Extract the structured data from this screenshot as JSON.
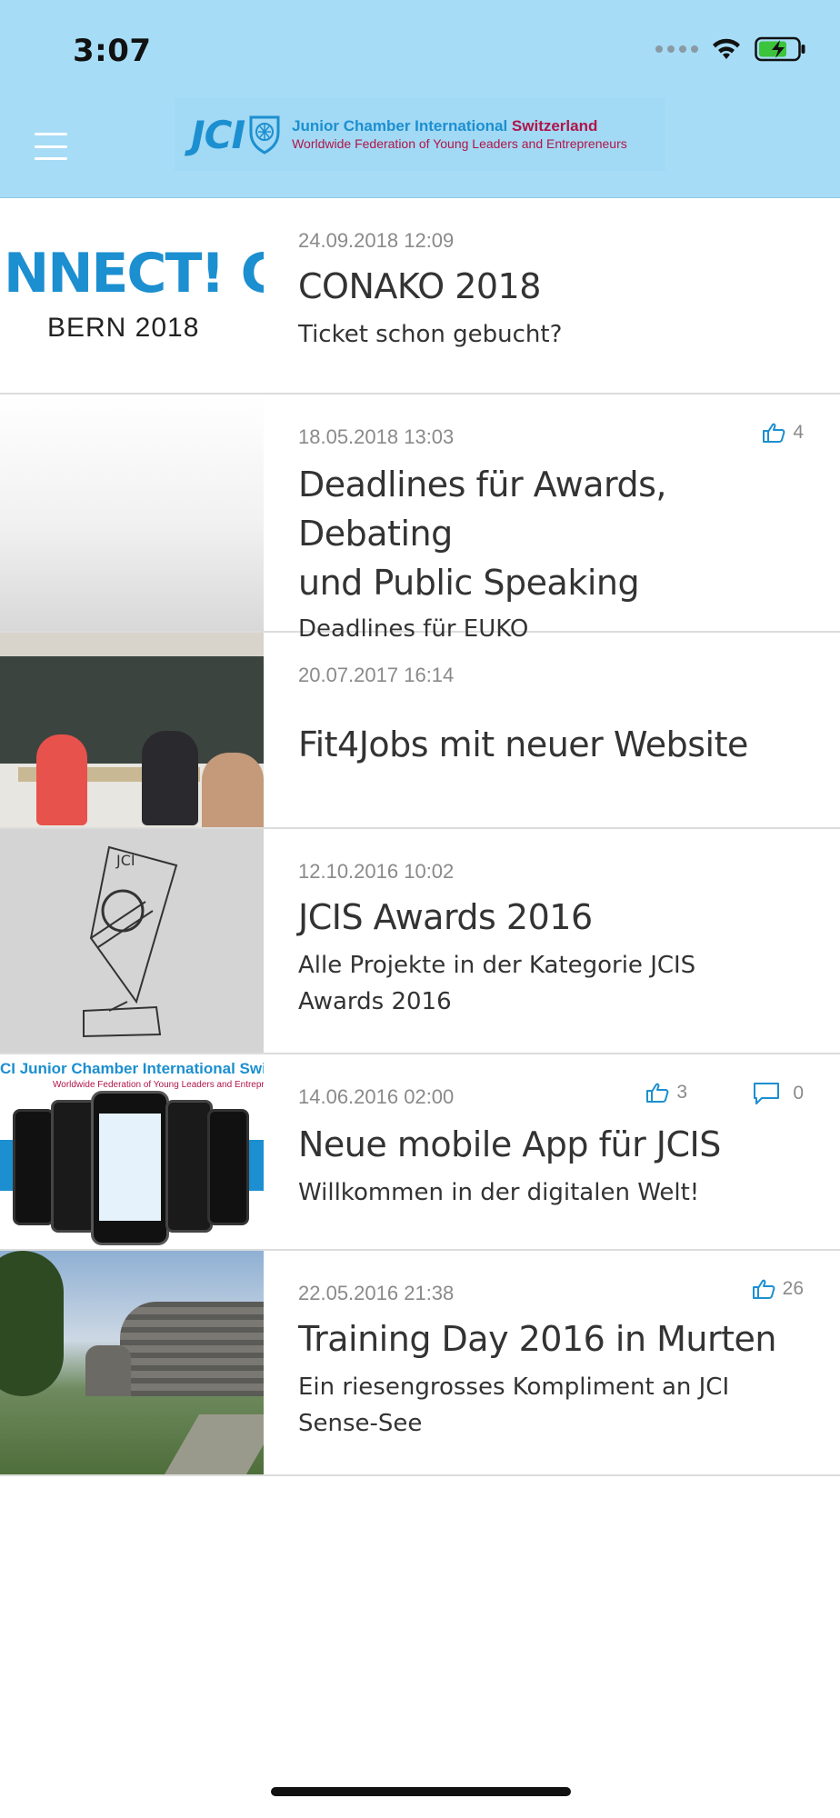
{
  "status_bar": {
    "time": "3:07"
  },
  "header": {
    "logo_mark": "JCI",
    "logo_line1": "Junior Chamber International",
    "logo_line1_accent": "Switzerland",
    "logo_line2": "Worldwide Federation of Young Leaders and Entrepreneurs"
  },
  "news": [
    {
      "date": "24.09.2018 12:09",
      "title": "CONAKO 2018",
      "subtitle": "Ticket schon gebucht?",
      "thumb_text1": "NNECT! C",
      "thumb_text2": "BERN 2018"
    },
    {
      "date": "18.05.2018 13:03",
      "likes": "4",
      "title_line1": "Deadlines für Awards, Debating",
      "title_line2": "und Public Speaking",
      "subtitle": "Deadlines für EUKO"
    },
    {
      "date": "20.07.2017 16:14",
      "title": "Fit4Jobs mit neuer Website"
    },
    {
      "date": "12.10.2016 10:02",
      "title": "JCIS Awards 2016",
      "subtitle_line1": "Alle Projekte in der Kategorie JCIS",
      "subtitle_line2": "Awards 2016"
    },
    {
      "date": "14.06.2016 02:00",
      "likes": "3",
      "comments": "0",
      "title": "Neue mobile App für JCIS",
      "subtitle": "Willkommen in der digitalen Welt!",
      "thumb_header": "CI Junior Chamber International Switzer",
      "thumb_sub": "Worldwide Federation of Young Leaders and Entrepr"
    },
    {
      "date": "22.05.2016 21:38",
      "likes": "26",
      "title": "Training Day 2016 in Murten",
      "subtitle_line1": "Ein riesengrosses Kompliment an JCI",
      "subtitle_line2": "Sense-See"
    }
  ],
  "colors": {
    "header_bg": "#a6dcf6",
    "accent": "#1c8fd0",
    "brand_red": "#b0154a",
    "divider": "#dcdcdc"
  }
}
